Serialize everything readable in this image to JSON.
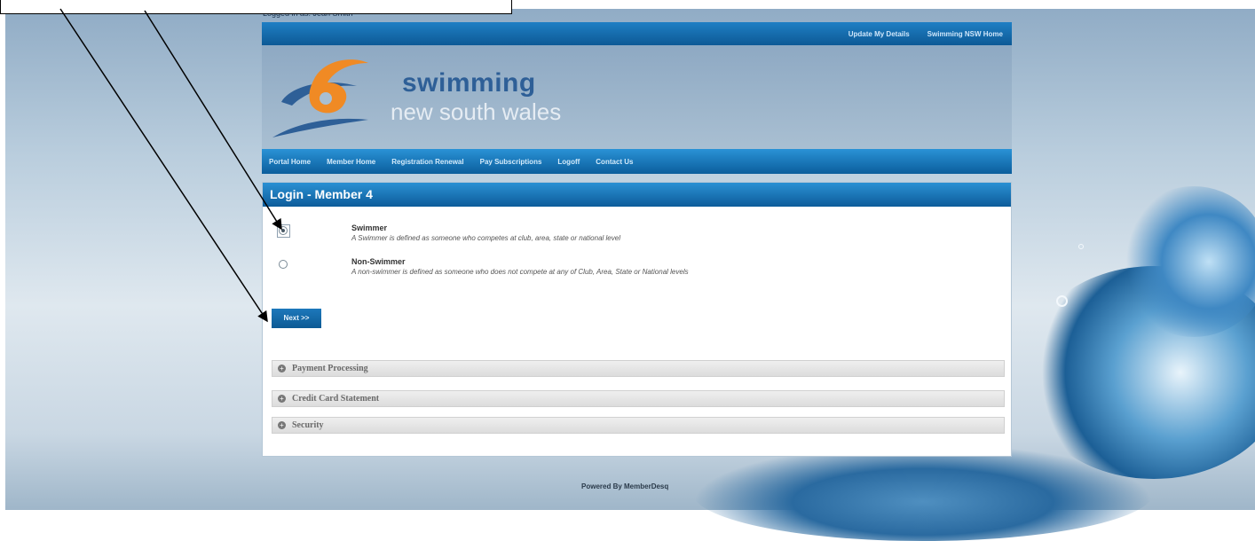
{
  "header": {
    "logged_in_text": "Logged in as: Jean Smith",
    "top_links": [
      "Update My Details",
      "Swimming NSW Home"
    ],
    "logo_line1": "swimming",
    "logo_line2": "new south wales"
  },
  "nav": {
    "items": [
      "Portal Home",
      "Member Home",
      "Registration Renewal",
      "Pay Subscriptions",
      "Logoff",
      "Contact Us"
    ]
  },
  "panel": {
    "title": "Login - Member 4",
    "options": [
      {
        "title": "Swimmer",
        "description": "A Swimmer is defined as someone who competes at club, area, state or national level",
        "selected": true
      },
      {
        "title": "Non-Swimmer",
        "description": "A non-swimmer is defined as someone who does not compete at any of Club, Area, State or National levels",
        "selected": false
      }
    ],
    "next_label": "Next >>"
  },
  "accordion": {
    "items": [
      "Payment Processing",
      "Credit Card Statement",
      "Security"
    ],
    "icon": "plus-circle-icon"
  },
  "footer": {
    "text": "Powered By MemberDesq"
  },
  "colors": {
    "nav_blue": "#0d5c9a",
    "brand_orange": "#f08a24",
    "brand_blue": "#2e5f97"
  }
}
